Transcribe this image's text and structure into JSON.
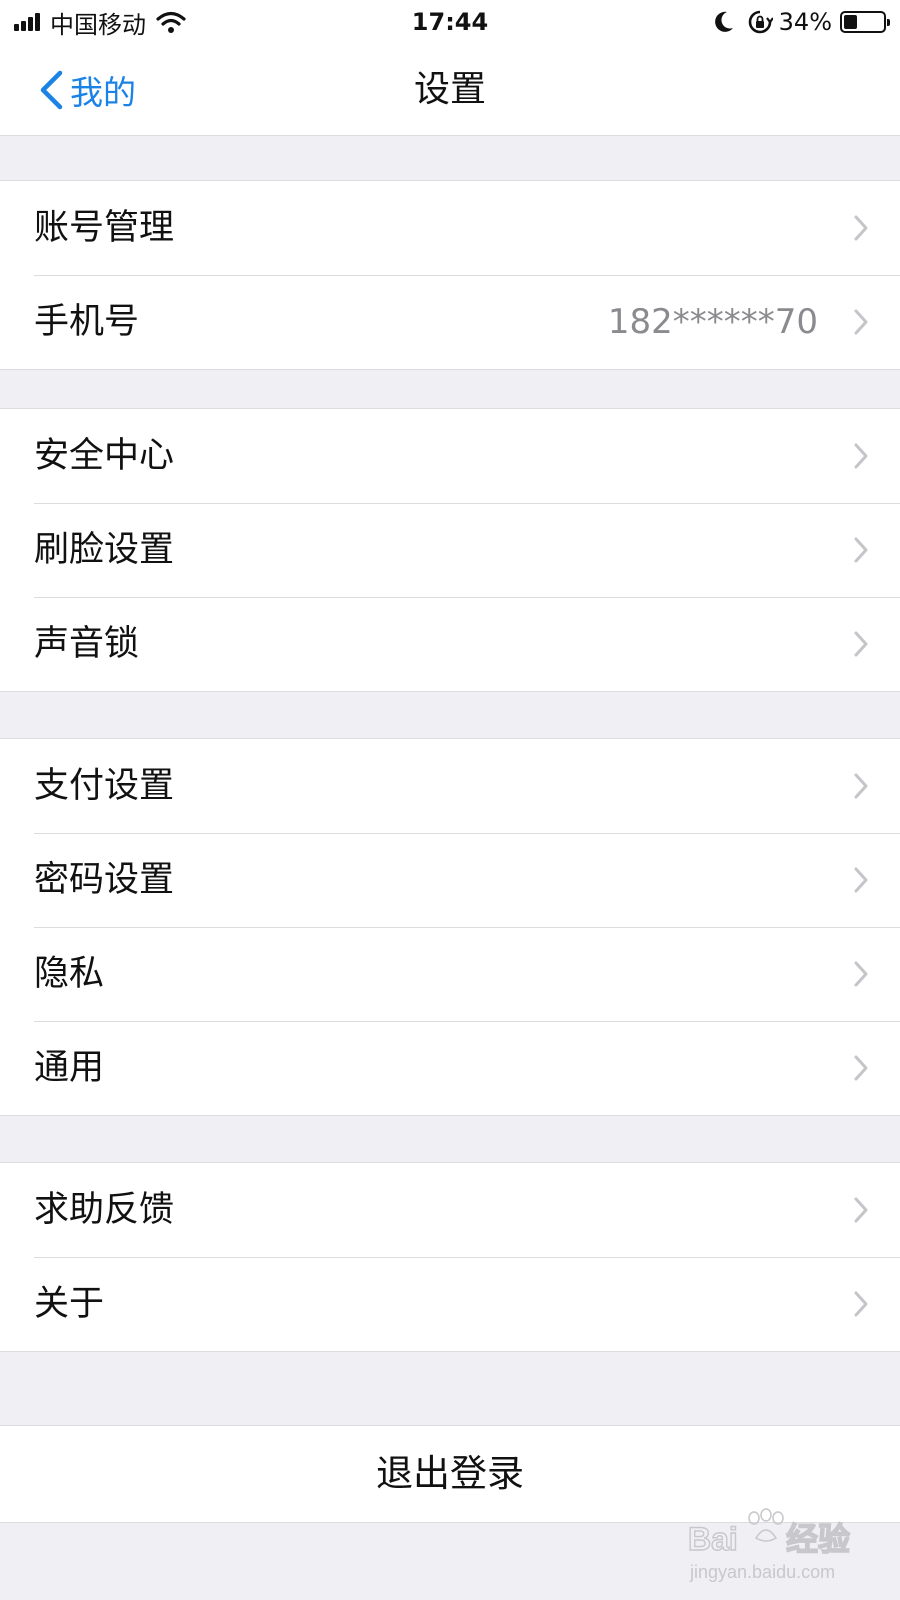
{
  "status_bar": {
    "carrier": "中国移动",
    "time": "17:44",
    "battery_percent_text": "34%",
    "battery_level": 0.34
  },
  "nav": {
    "back_label": "我的",
    "title": "设置"
  },
  "groups": [
    {
      "items": [
        {
          "label": "账号管理",
          "value": ""
        },
        {
          "label": "手机号",
          "value": "182******70"
        }
      ]
    },
    {
      "items": [
        {
          "label": "安全中心",
          "value": ""
        },
        {
          "label": "刷脸设置",
          "value": ""
        },
        {
          "label": "声音锁",
          "value": ""
        }
      ]
    },
    {
      "items": [
        {
          "label": "支付设置",
          "value": ""
        },
        {
          "label": "密码设置",
          "value": ""
        },
        {
          "label": "隐私",
          "value": ""
        },
        {
          "label": "通用",
          "value": ""
        }
      ]
    },
    {
      "items": [
        {
          "label": "求助反馈",
          "value": ""
        },
        {
          "label": "关于",
          "value": ""
        }
      ]
    }
  ],
  "logout_label": "退出登录",
  "watermark": {
    "brand": "Baidu经验",
    "url": "jingyan.baidu.com"
  },
  "colors": {
    "accent": "#1b82e6",
    "background": "#efeff4",
    "secondary_text": "#8a8a8f"
  }
}
